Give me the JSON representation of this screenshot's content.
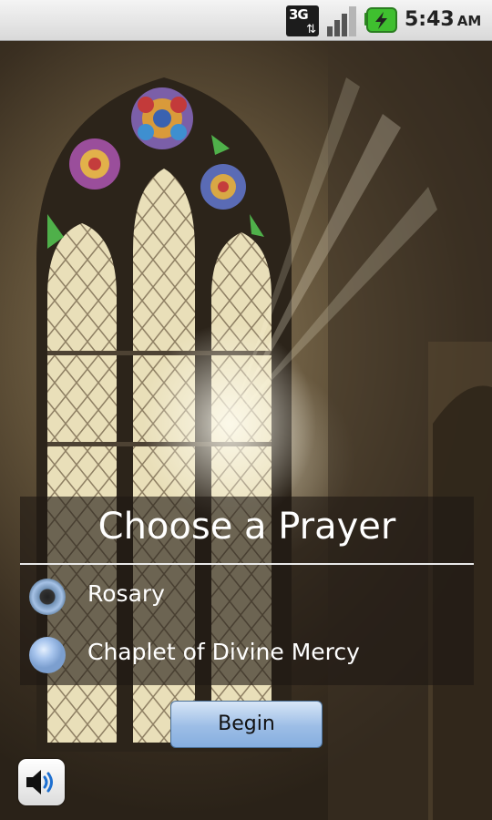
{
  "status_bar": {
    "network_type": "3G",
    "network_arrows": "⇅",
    "time": "5:43",
    "ampm": "AM"
  },
  "prayer_panel": {
    "title": "Choose a Prayer",
    "options": [
      {
        "label": "Rosary",
        "selected": true
      },
      {
        "label": "Chaplet of Divine Mercy",
        "selected": false
      }
    ]
  },
  "actions": {
    "begin_label": "Begin"
  },
  "icons": {
    "signal": "signal-strength-icon",
    "battery": "battery-charging-icon",
    "speaker": "speaker-volume-icon"
  },
  "colors": {
    "battery_green": "#3fbf2f",
    "button_blue": "#9cbde6",
    "radio_blue": "#a6c2e6"
  }
}
